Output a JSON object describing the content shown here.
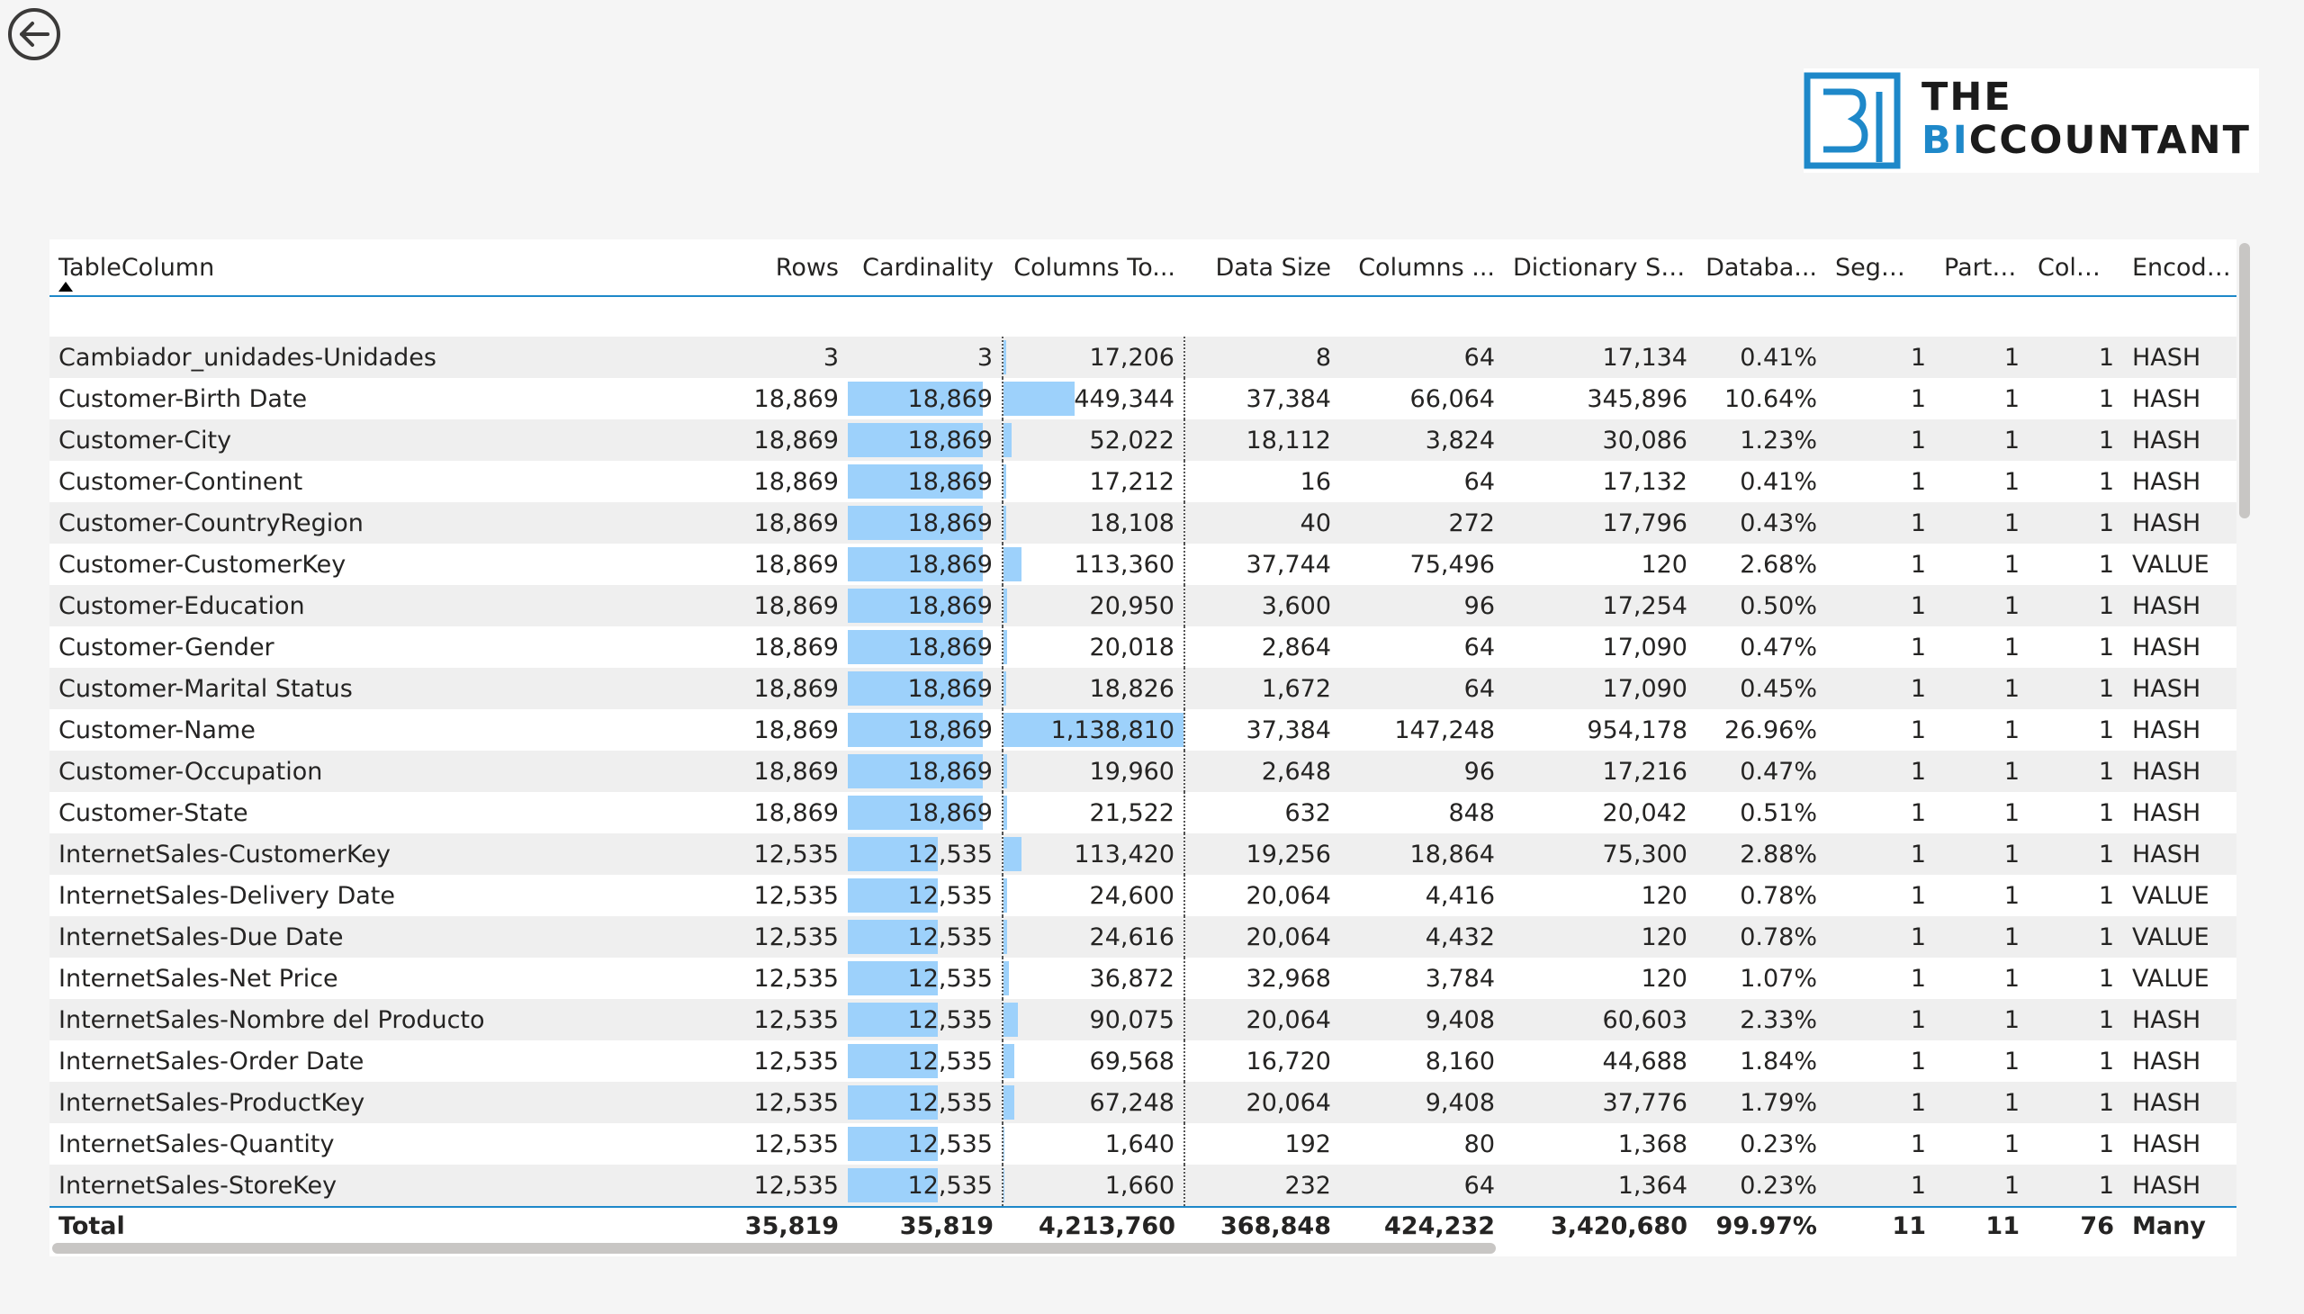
{
  "app": {
    "back_icon": "back-arrow-icon",
    "logo": {
      "line1": "THE",
      "line2_prefix": "BI",
      "line2_rest": "CCOUNTANT",
      "brand_color": "#1e88c9"
    }
  },
  "table": {
    "sort_indicator": "sort-ascending-icon",
    "bar_color": "#9dd1fb",
    "columns": [
      "TableColumn",
      "Rows",
      "Cardinality",
      "Columns To...",
      "Data Size",
      "Columns ...",
      "Dictionary Size",
      "Databa...",
      "Segm...",
      "Parti...",
      "Colu...",
      "Encoding"
    ],
    "rows": [
      [
        "Cambiador_unidades-Unidades",
        "3",
        "3",
        "17,206",
        "8",
        "64",
        "17,134",
        "0.41%",
        "1",
        "1",
        "1",
        "HASH"
      ],
      [
        "Customer-Birth Date",
        "18,869",
        "18,869",
        "449,344",
        "37,384",
        "66,064",
        "345,896",
        "10.64%",
        "1",
        "1",
        "1",
        "HASH"
      ],
      [
        "Customer-City",
        "18,869",
        "18,869",
        "52,022",
        "18,112",
        "3,824",
        "30,086",
        "1.23%",
        "1",
        "1",
        "1",
        "HASH"
      ],
      [
        "Customer-Continent",
        "18,869",
        "18,869",
        "17,212",
        "16",
        "64",
        "17,132",
        "0.41%",
        "1",
        "1",
        "1",
        "HASH"
      ],
      [
        "Customer-CountryRegion",
        "18,869",
        "18,869",
        "18,108",
        "40",
        "272",
        "17,796",
        "0.43%",
        "1",
        "1",
        "1",
        "HASH"
      ],
      [
        "Customer-CustomerKey",
        "18,869",
        "18,869",
        "113,360",
        "37,744",
        "75,496",
        "120",
        "2.68%",
        "1",
        "1",
        "1",
        "VALUE"
      ],
      [
        "Customer-Education",
        "18,869",
        "18,869",
        "20,950",
        "3,600",
        "96",
        "17,254",
        "0.50%",
        "1",
        "1",
        "1",
        "HASH"
      ],
      [
        "Customer-Gender",
        "18,869",
        "18,869",
        "20,018",
        "2,864",
        "64",
        "17,090",
        "0.47%",
        "1",
        "1",
        "1",
        "HASH"
      ],
      [
        "Customer-Marital Status",
        "18,869",
        "18,869",
        "18,826",
        "1,672",
        "64",
        "17,090",
        "0.45%",
        "1",
        "1",
        "1",
        "HASH"
      ],
      [
        "Customer-Name",
        "18,869",
        "18,869",
        "1,138,810",
        "37,384",
        "147,248",
        "954,178",
        "26.96%",
        "1",
        "1",
        "1",
        "HASH"
      ],
      [
        "Customer-Occupation",
        "18,869",
        "18,869",
        "19,960",
        "2,648",
        "96",
        "17,216",
        "0.47%",
        "1",
        "1",
        "1",
        "HASH"
      ],
      [
        "Customer-State",
        "18,869",
        "18,869",
        "21,522",
        "632",
        "848",
        "20,042",
        "0.51%",
        "1",
        "1",
        "1",
        "HASH"
      ],
      [
        "InternetSales-CustomerKey",
        "12,535",
        "12,535",
        "113,420",
        "19,256",
        "18,864",
        "75,300",
        "2.88%",
        "1",
        "1",
        "1",
        "HASH"
      ],
      [
        "InternetSales-Delivery Date",
        "12,535",
        "12,535",
        "24,600",
        "20,064",
        "4,416",
        "120",
        "0.78%",
        "1",
        "1",
        "1",
        "VALUE"
      ],
      [
        "InternetSales-Due Date",
        "12,535",
        "12,535",
        "24,616",
        "20,064",
        "4,432",
        "120",
        "0.78%",
        "1",
        "1",
        "1",
        "VALUE"
      ],
      [
        "InternetSales-Net Price",
        "12,535",
        "12,535",
        "36,872",
        "32,968",
        "3,784",
        "120",
        "1.07%",
        "1",
        "1",
        "1",
        "VALUE"
      ],
      [
        "InternetSales-Nombre del Producto",
        "12,535",
        "12,535",
        "90,075",
        "20,064",
        "9,408",
        "60,603",
        "2.33%",
        "1",
        "1",
        "1",
        "HASH"
      ],
      [
        "InternetSales-Order Date",
        "12,535",
        "12,535",
        "69,568",
        "16,720",
        "8,160",
        "44,688",
        "1.84%",
        "1",
        "1",
        "1",
        "HASH"
      ],
      [
        "InternetSales-ProductKey",
        "12,535",
        "12,535",
        "67,248",
        "20,064",
        "9,408",
        "37,776",
        "1.79%",
        "1",
        "1",
        "1",
        "HASH"
      ],
      [
        "InternetSales-Quantity",
        "12,535",
        "12,535",
        "1,640",
        "192",
        "80",
        "1,368",
        "0.23%",
        "1",
        "1",
        "1",
        "HASH"
      ],
      [
        "InternetSales-StoreKey",
        "12,535",
        "12,535",
        "1,660",
        "232",
        "64",
        "1,364",
        "0.23%",
        "1",
        "1",
        "1",
        "HASH"
      ]
    ],
    "total": [
      "Total",
      "35,819",
      "35,819",
      "4,213,760",
      "368,848",
      "424,232",
      "3,420,680",
      "99.97%",
      "11",
      "11",
      "76",
      "Many"
    ]
  }
}
